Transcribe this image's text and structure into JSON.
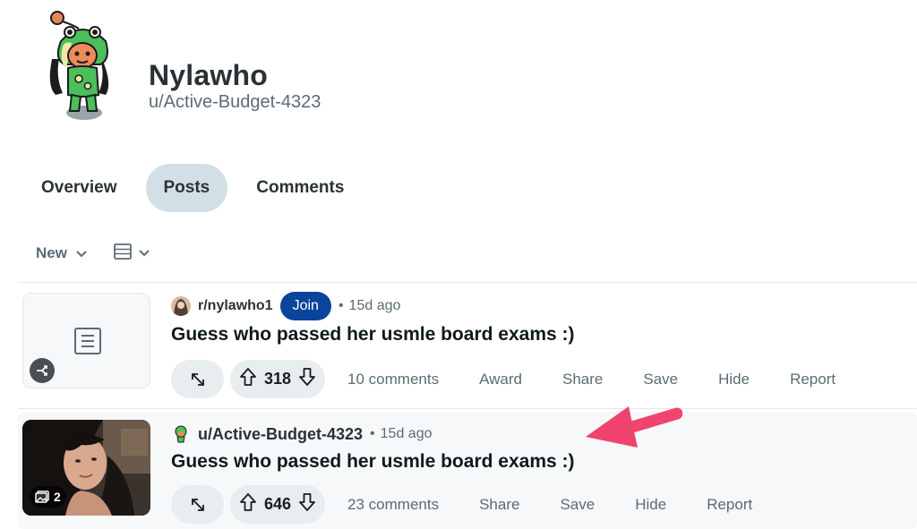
{
  "profile": {
    "display_name": "Nylawho",
    "username": "u/Active-Budget-4323"
  },
  "tabs": [
    {
      "label": "Overview",
      "active": false
    },
    {
      "label": "Posts",
      "active": true
    },
    {
      "label": "Comments",
      "active": false
    }
  ],
  "sort": {
    "selected": "New"
  },
  "posts": [
    {
      "source": "r/nylawho1",
      "join_label": "Join",
      "dot": "•",
      "time": "15d ago",
      "title": "Guess who passed her usmle board exams :)",
      "score": "318",
      "comments": "10 comments",
      "award": "Award",
      "share": "Share",
      "save": "Save",
      "hide": "Hide",
      "report": "Report"
    },
    {
      "source": "u/Active-Budget-4323",
      "dot": "•",
      "time": "15d ago",
      "title": "Guess who passed her usmle board exams :)",
      "gallery_count": "2",
      "score": "646",
      "comments": "23 comments",
      "share": "Share",
      "save": "Save",
      "hide": "Hide",
      "report": "Report"
    }
  ],
  "colors": {
    "join_button": "#0a449b",
    "annotation_arrow": "#f0436e",
    "active_tab": "#d3dfe6"
  }
}
